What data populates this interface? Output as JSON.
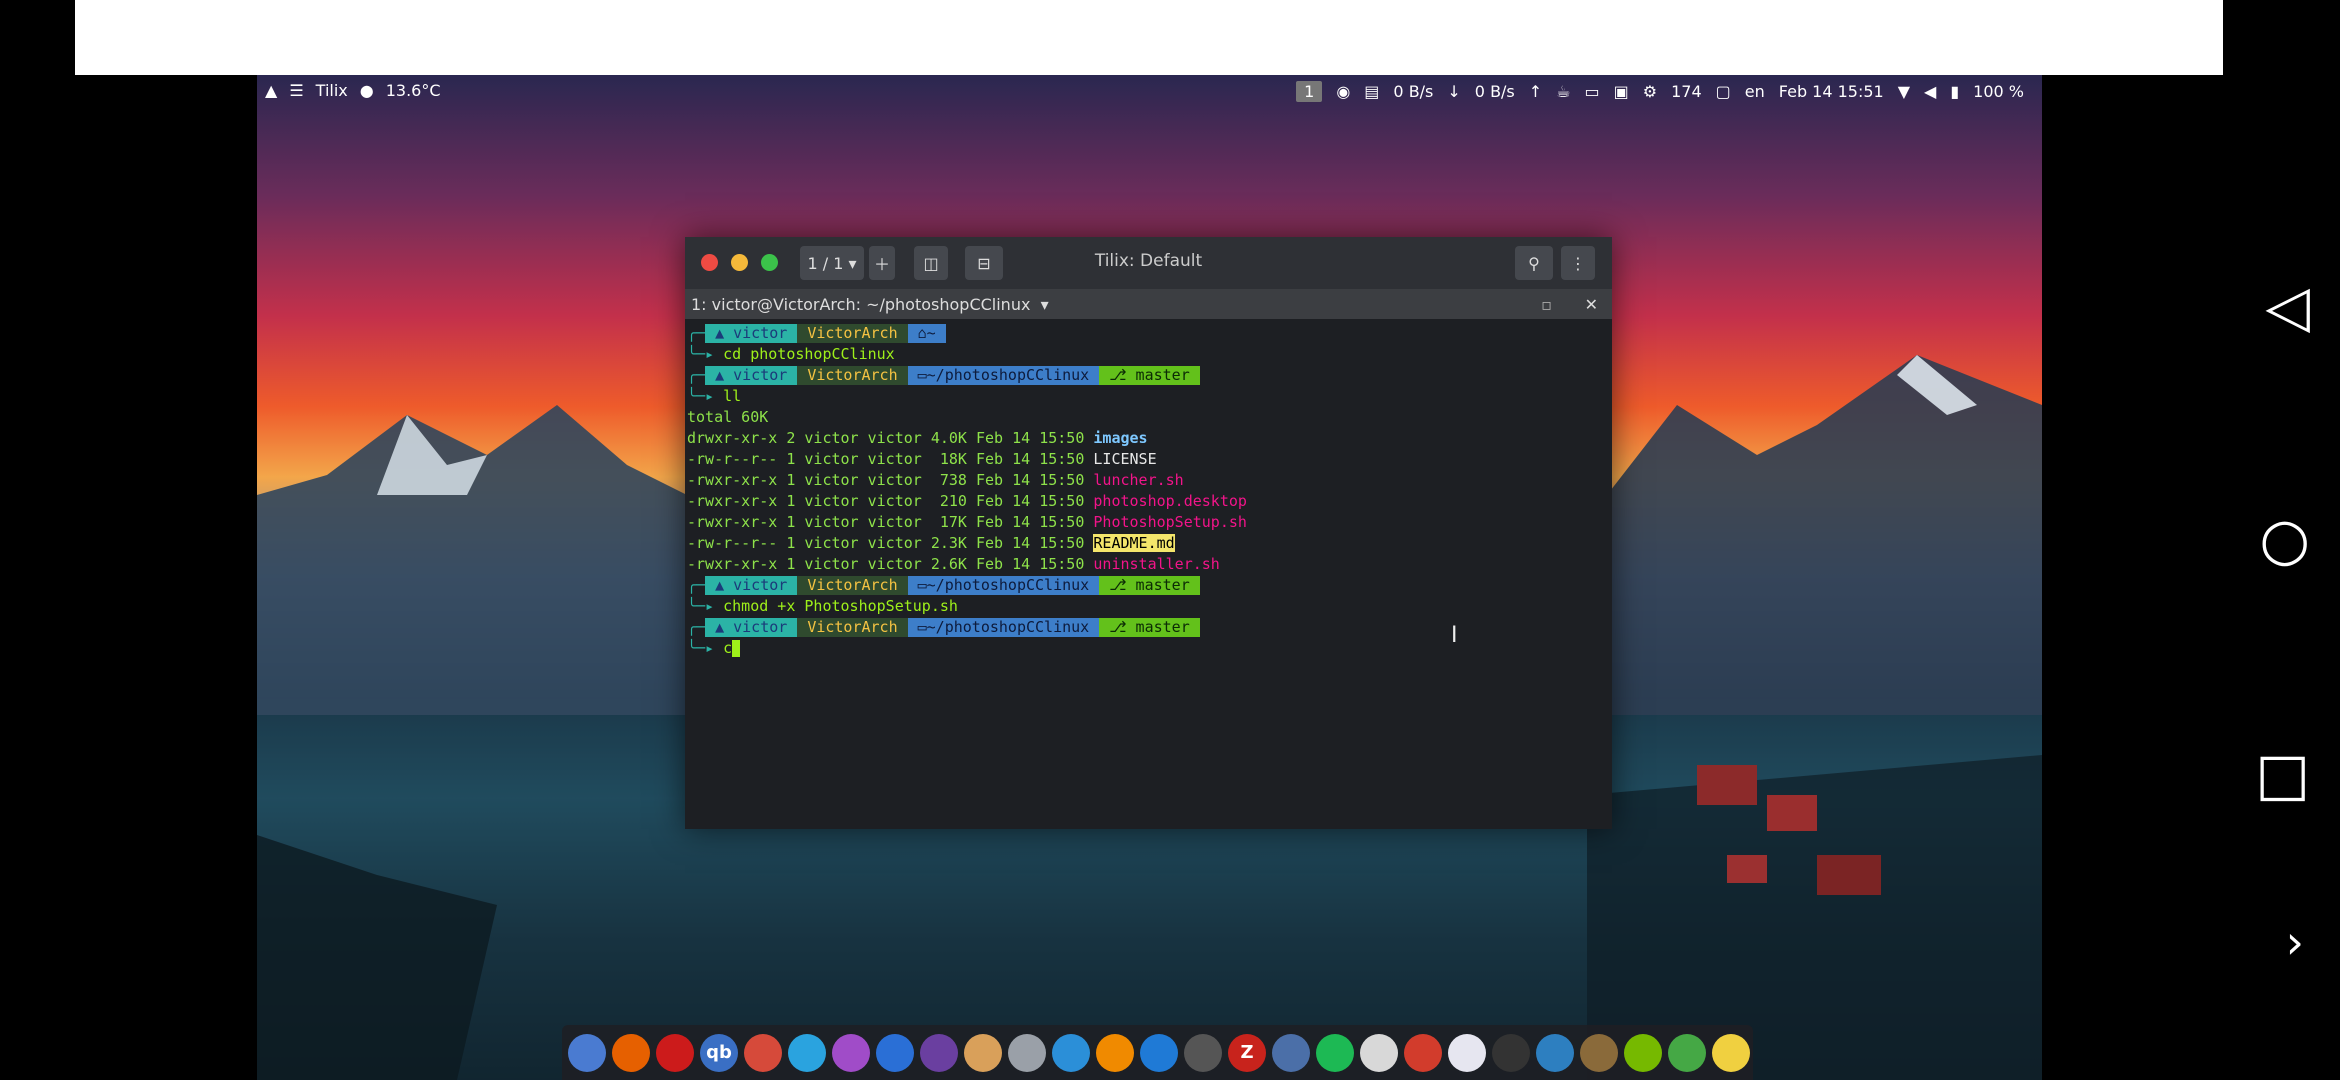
{
  "panel": {
    "left": {
      "app_label": "Tilix",
      "temperature": "13.6°C"
    },
    "right": {
      "workspace": "1",
      "net_down": "0 B/s",
      "net_up": "0 B/s",
      "cpu_temp": "174",
      "lang": "en",
      "datetime": "Feb 14 15:51",
      "battery": "100 %"
    }
  },
  "terminal": {
    "title": "Tilix: Default",
    "session_counter": "1 / 1",
    "session_title": "1: victor@VictorArch: ~/photoshopCClinux",
    "prompt": {
      "user": "victor",
      "host": "VictorArch",
      "home": "~",
      "dir": "~/photoshopCClinux",
      "branch": "master"
    },
    "commands": [
      "cd photoshopCClinux",
      "ll",
      "chmod +x PhotoshopSetup.sh",
      "c"
    ],
    "total": "total 60K",
    "listing": [
      {
        "perm": "drwxr-xr-x 2 victor victor 4.0K Feb 14 15:50 ",
        "name": "images",
        "cls": "f-dir"
      },
      {
        "perm": "-rw-r--r-- 1 victor victor  18K Feb 14 15:50 ",
        "name": "LICENSE",
        "cls": "f-plain"
      },
      {
        "perm": "-rwxr-xr-x 1 victor victor  738 Feb 14 15:50 ",
        "name": "luncher.sh",
        "cls": "f-exe"
      },
      {
        "perm": "-rwxr-xr-x 1 victor victor  210 Feb 14 15:50 ",
        "name": "photoshop.desktop",
        "cls": "f-exe"
      },
      {
        "perm": "-rwxr-xr-x 1 victor victor  17K Feb 14 15:50 ",
        "name": "PhotoshopSetup.sh",
        "cls": "f-exe"
      },
      {
        "perm": "-rw-r--r-- 1 victor victor 2.3K Feb 14 15:50 ",
        "name": "README.md",
        "cls": "f-readme"
      },
      {
        "perm": "-rwxr-xr-x 1 victor victor 2.6K Feb 14 15:50 ",
        "name": "uninstaller.sh",
        "cls": "f-exe"
      }
    ]
  },
  "dock": {
    "apps": [
      {
        "name": "chromium-icon",
        "glyph": "",
        "color": "#4a7bd1"
      },
      {
        "name": "firefox-icon",
        "glyph": "",
        "color": "#e66000"
      },
      {
        "name": "opera-icon",
        "glyph": "",
        "color": "#cc1b1b"
      },
      {
        "name": "qbittorrent-icon",
        "glyph": "qb",
        "color": "#3a6fc4"
      },
      {
        "name": "app-red-icon",
        "glyph": "",
        "color": "#d64a3a"
      },
      {
        "name": "telegram-icon",
        "glyph": "",
        "color": "#2aa3df"
      },
      {
        "name": "app-purple-icon",
        "glyph": "",
        "color": "#a04cc8"
      },
      {
        "name": "video-player-icon",
        "glyph": "",
        "color": "#2a6fd6"
      },
      {
        "name": "media-player-icon",
        "glyph": "",
        "color": "#6a3fa0"
      },
      {
        "name": "coffee-icon",
        "glyph": "",
        "color": "#d9a05a"
      },
      {
        "name": "database-icon",
        "glyph": "",
        "color": "#9aa0a8"
      },
      {
        "name": "upload-icon",
        "glyph": "",
        "color": "#2b8fd8"
      },
      {
        "name": "vlc-icon",
        "glyph": "",
        "color": "#f08a00"
      },
      {
        "name": "vscode-icon",
        "glyph": "",
        "color": "#1f7ad6"
      },
      {
        "name": "obs-icon",
        "glyph": "",
        "color": "#555"
      },
      {
        "name": "filezilla-icon",
        "glyph": "Z",
        "color": "#c8231c"
      },
      {
        "name": "archive-icon",
        "glyph": "",
        "color": "#4b6fa8"
      },
      {
        "name": "spotify-icon",
        "glyph": "",
        "color": "#1db954"
      },
      {
        "name": "document-viewer-icon",
        "glyph": "",
        "color": "#d8d8d8"
      },
      {
        "name": "pdf-icon",
        "glyph": "",
        "color": "#d23c2c"
      },
      {
        "name": "text-editor-icon",
        "glyph": "",
        "color": "#e6e6f0"
      },
      {
        "name": "terminal-icon",
        "glyph": "",
        "color": "#333"
      },
      {
        "name": "system-monitor-icon",
        "glyph": "",
        "color": "#2d7fc0"
      },
      {
        "name": "gimp-icon",
        "glyph": "",
        "color": "#8a6a3a"
      },
      {
        "name": "nvidia-icon",
        "glyph": "",
        "color": "#76b900"
      },
      {
        "name": "image-viewer-icon",
        "glyph": "",
        "color": "#45a845"
      },
      {
        "name": "notes-icon",
        "glyph": "",
        "color": "#f0d040"
      }
    ]
  }
}
